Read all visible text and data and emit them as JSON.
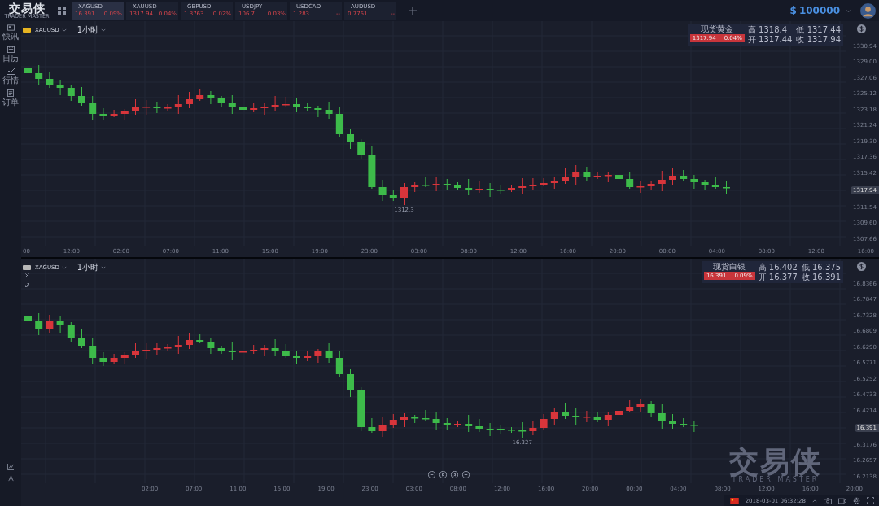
{
  "app": {
    "logo": "交易侠",
    "logo_subtitle": "TRADER MASTER"
  },
  "tickers": [
    {
      "symbol": "XAGUSD",
      "price": "16.391",
      "change": "0.09%",
      "selected": true
    },
    {
      "symbol": "XAUUSD",
      "price": "1317.94",
      "change": "0.04%",
      "selected": false
    },
    {
      "symbol": "GBPUSD",
      "price": "1.3763",
      "change": "0.02%",
      "selected": false
    },
    {
      "symbol": "USDJPY",
      "price": "106.7",
      "change": "0.03%",
      "selected": false
    },
    {
      "symbol": "USDCAD",
      "price": "1.283",
      "change": "--",
      "selected": false
    },
    {
      "symbol": "AUDUSD",
      "price": "0.7761",
      "change": "--",
      "selected": false
    }
  ],
  "account": {
    "currency": "$",
    "balance": "100000"
  },
  "sidebar": {
    "items": [
      {
        "label": "快讯",
        "kind": "news"
      },
      {
        "label": "日历",
        "kind": "calendar"
      },
      {
        "label": "行情",
        "kind": "chart"
      },
      {
        "label": "订单",
        "kind": "orders"
      }
    ]
  },
  "panes": [
    {
      "symbol": "XAUUSD",
      "color": "#e6b422",
      "timeframe": "1小时",
      "info": {
        "name": "现货黄金",
        "price": "1317.94",
        "change": "0.04%",
        "high_label": "高",
        "high": "1318.4",
        "low_label": "低",
        "low": "1317.44",
        "open_label": "开",
        "open": "1317.44",
        "close_label": "收",
        "close": "1317.94"
      },
      "price_tag": "1317.94",
      "low_marker": "1312.3",
      "yticks": [
        "1330.94",
        "1329.00",
        "1327.06",
        "1325.12",
        "1323.18",
        "1321.24",
        "1319.30",
        "1317.36",
        "1315.42",
        "1311.54",
        "1309.60",
        "1307.66"
      ],
      "xticks": [
        "00",
        "12:00",
        "02:00",
        "07:00",
        "11:00",
        "15:00",
        "19:00",
        "23:00",
        "03:00",
        "08:00",
        "12:00",
        "16:00",
        "20:00",
        "00:00",
        "04:00",
        "08:00",
        "12:00",
        "16:00"
      ]
    },
    {
      "symbol": "XAGUSD",
      "color": "#b8b8b8",
      "timeframe": "1小时",
      "window_buttons": [
        {
          "kind": "close"
        },
        {
          "kind": "expand"
        }
      ],
      "navigation_buttons": [
        {
          "kind": "zoom_out"
        },
        {
          "kind": "scroll_left"
        },
        {
          "kind": "scroll_right"
        },
        {
          "kind": "zoom_in"
        }
      ],
      "info": {
        "name": "现货白银",
        "price": "16.391",
        "change": "0.09%",
        "high_label": "高",
        "high": "16.402",
        "low_label": "低",
        "low": "16.375",
        "open_label": "开",
        "open": "16.377",
        "close_label": "收",
        "close": "16.391"
      },
      "price_tag": "16.391",
      "low_marker": "16.327",
      "yticks": [
        "16.8366",
        "16.7847",
        "16.7328",
        "16.6809",
        "16.6290",
        "16.5771",
        "16.5252",
        "16.4733",
        "16.4214",
        "16.3176",
        "16.2657",
        "16.2138"
      ],
      "xticks": [
        "02:00",
        "07:00",
        "11:00",
        "15:00",
        "19:00",
        "23:00",
        "03:00",
        "08:00",
        "12:00",
        "16:00",
        "20:00",
        "00:00",
        "04:00",
        "08:00",
        "12:00",
        "16:00",
        "20:00"
      ],
      "watermark": {
        "title": "交易侠",
        "subtitle": "TRADER MASTER"
      }
    }
  ],
  "status_bar": {
    "datetime": "2018-03-01 06:32:28"
  }
}
